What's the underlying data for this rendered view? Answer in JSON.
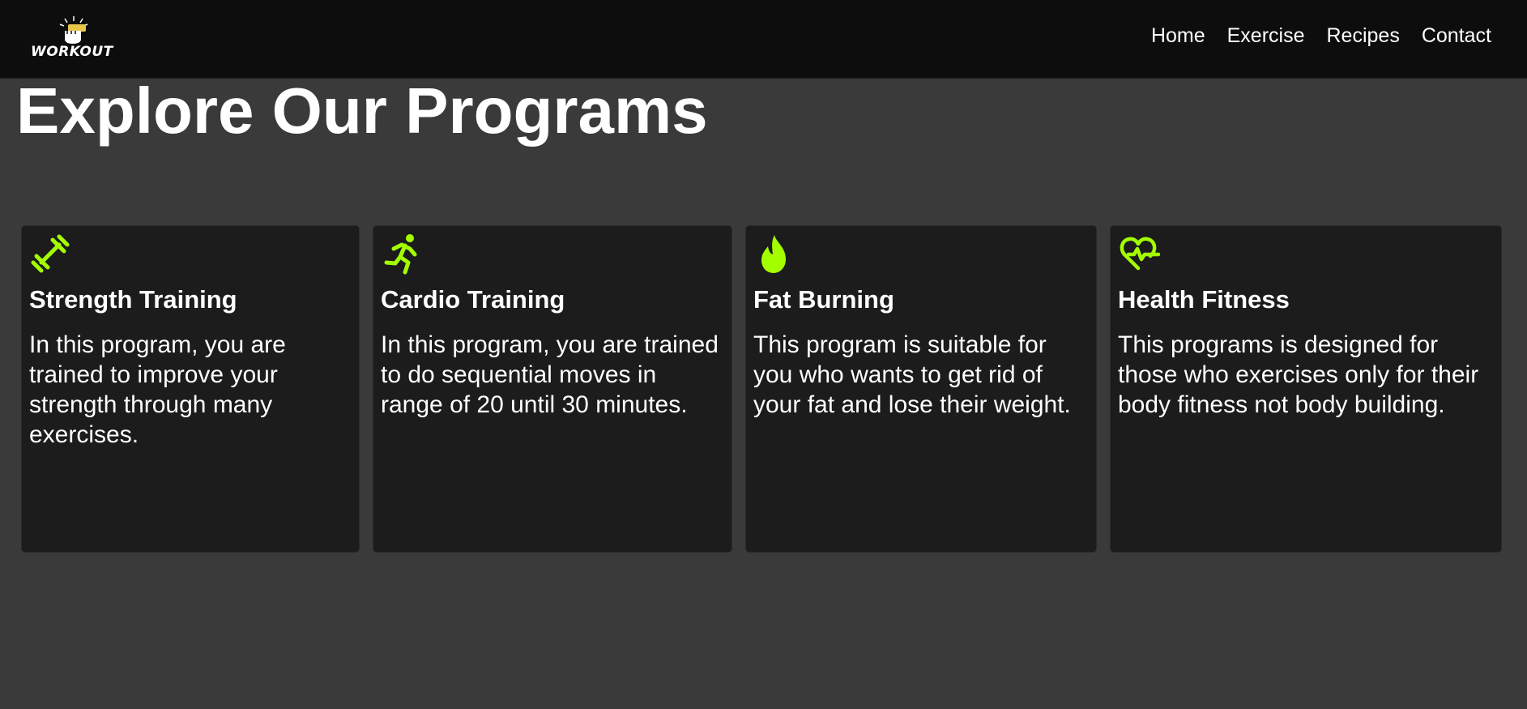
{
  "navbar": {
    "logo_text": "WORKOUT",
    "links": [
      {
        "label": "Home"
      },
      {
        "label": "Exercise"
      },
      {
        "label": "Recipes"
      },
      {
        "label": "Contact"
      }
    ]
  },
  "main": {
    "title": "Explore Our Programs",
    "accent_color": "#a3ff00",
    "cards": [
      {
        "icon": "dumbbell-icon",
        "title": "Strength Training",
        "description": "In this program, you are trained to improve your strength through many exercises."
      },
      {
        "icon": "running-person-icon",
        "title": "Cardio Training",
        "description": "In this program, you are trained to do sequential moves in range of 20 until 30 minutes."
      },
      {
        "icon": "fire-icon",
        "title": "Fat Burning",
        "description": "This program is suitable for you who wants to get rid of your fat and lose their weight."
      },
      {
        "icon": "heart-pulse-icon",
        "title": "Health Fitness",
        "description": "This programs is designed for those who exercises only for their body fitness not body building."
      }
    ]
  }
}
